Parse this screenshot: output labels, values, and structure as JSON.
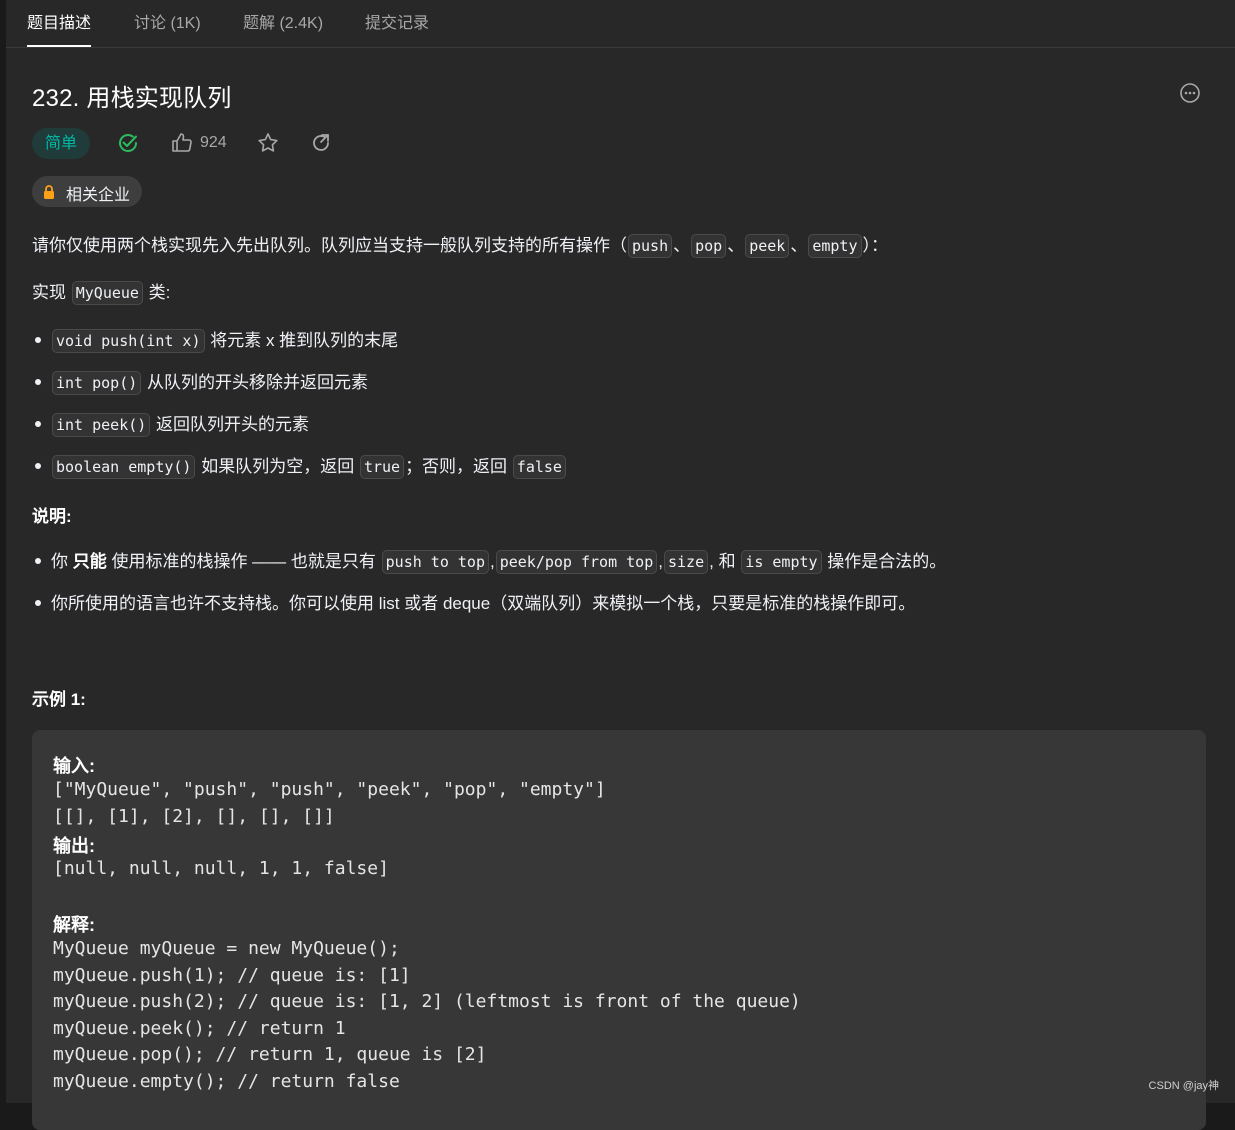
{
  "tabs": [
    {
      "label": "题目描述"
    },
    {
      "label": "讨论 (1K)"
    },
    {
      "label": "题解 (2.4K)"
    },
    {
      "label": "提交记录"
    }
  ],
  "problem": {
    "title": "232. 用栈实现队列",
    "difficulty": "简单",
    "likes": "924",
    "company_tag": "相关企业"
  },
  "description": {
    "intro_text": "请你仅使用两个栈实现先入先出队列。队列应当支持一般队列支持的所有操作（",
    "ops": [
      "push",
      "pop",
      "peek",
      "empty"
    ],
    "sep": "、",
    "intro_end": "）：",
    "impl_prefix": "实现 ",
    "impl_class": "MyQueue",
    "impl_suffix": " 类:",
    "methods": [
      {
        "code": "void push(int x)",
        "text": "将元素 x 推到队列的末尾"
      },
      {
        "code": "int pop()",
        "text": "从队列的开头移除并返回元素"
      },
      {
        "code": "int peek()",
        "text": "返回队列开头的元素"
      },
      {
        "code": "boolean empty()",
        "text": "如果队列为空，返回",
        "code2": "true",
        "text2": "；否则，返回",
        "code3": "false"
      }
    ],
    "notes_heading": "说明:",
    "note1": {
      "prefix": "你 ",
      "bold": "只能",
      "mid": " 使用标准的栈操作 —— 也就是只有 ",
      "codes": [
        "push to top",
        "peek/pop from top",
        "size",
        "is empty"
      ],
      "comma": ",",
      "and": " 和 ",
      "suffix": " 操作是合法的。"
    },
    "note2": "你所使用的语言也许不支持栈。你可以使用 list 或者 deque（双端队列）来模拟一个栈，只要是标准的栈操作即可。"
  },
  "example": {
    "heading": "示例 1:",
    "input_label": "输入:",
    "input_lines": [
      "[\"MyQueue\", \"push\", \"push\", \"peek\", \"pop\", \"empty\"]",
      "[[], [1], [2], [], [], []]"
    ],
    "output_label": "输出:",
    "output_line": "[null, null, null, 1, 1, false]",
    "explain_label": "解释:",
    "explain_lines": [
      "MyQueue myQueue = new MyQueue();",
      "myQueue.push(1); // queue is: [1]",
      "myQueue.push(2); // queue is: [1, 2] (leftmost is front of the queue)",
      "myQueue.peek(); // return 1",
      "myQueue.pop(); // return 1, queue is [2]",
      "myQueue.empty(); // return false"
    ]
  },
  "watermark": "CSDN @jay神",
  "colors": {
    "easy": "#00b8a3",
    "solved": "#2cbb5d",
    "lock": "#ffa116"
  }
}
